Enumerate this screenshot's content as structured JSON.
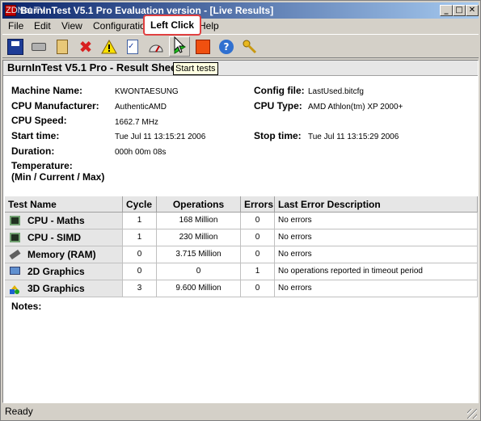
{
  "window": {
    "title": "BurnInTest V5.1 Pro Evaluation version - [Live Results]",
    "watermark": "ZDNet TV",
    "controls": {
      "minimize": "_",
      "maximize": "□",
      "close": "✕"
    }
  },
  "menu": {
    "items": [
      "File",
      "Edit",
      "View",
      "Configuration",
      "Help"
    ]
  },
  "toolbar": {
    "icons": [
      "save-icon",
      "print-icon",
      "clipboard-icon",
      "stop-icon",
      "warning-icon",
      "checklist-icon",
      "gauge-icon",
      "start-icon",
      "stop-square-icon",
      "help-icon",
      "key-icon"
    ]
  },
  "annotation": {
    "callout": "Left Click",
    "tooltip": "Start tests"
  },
  "sheet": {
    "header": "BurnInTest V5.1 Pro - Result Sheet",
    "machine_name_label": "Machine Name:",
    "machine_name": "KWONTAESUNG",
    "cpu_manufacturer_label": "CPU Manufacturer:",
    "cpu_manufacturer": "AuthenticAMD",
    "cpu_speed_label": "CPU Speed:",
    "cpu_speed": "1662.7 MHz",
    "start_time_label": "Start time:",
    "start_time": "Tue Jul 11 13:15:21 2006",
    "duration_label": "Duration:",
    "duration": "000h 00m 08s",
    "temperature_label": "Temperature:",
    "temperature_sub": "(Min / Current / Max)",
    "config_file_label": "Config file:",
    "config_file": "LastUsed.bitcfg",
    "cpu_type_label": "CPU Type:",
    "cpu_type": "AMD Athlon(tm) XP 2000+",
    "stop_time_label": "Stop time:",
    "stop_time": "Tue Jul 11 13:15:29 2006",
    "notes_label": "Notes:"
  },
  "table": {
    "headers": [
      "Test Name",
      "Cycle",
      "Operations",
      "Errors",
      "Last Error Description"
    ],
    "rows": [
      {
        "name": "CPU - Maths",
        "cycle": "1",
        "operations": "168 Million",
        "errors": "0",
        "description": "No errors",
        "icon": "chip-icon"
      },
      {
        "name": "CPU - SIMD",
        "cycle": "1",
        "operations": "230 Million",
        "errors": "0",
        "description": "No errors",
        "icon": "chip-icon"
      },
      {
        "name": "Memory (RAM)",
        "cycle": "0",
        "operations": "3.715 Million",
        "errors": "0",
        "description": "No errors",
        "icon": "memory-icon"
      },
      {
        "name": "2D Graphics",
        "cycle": "0",
        "operations": "0",
        "errors": "1",
        "description": "No operations reported in timeout period",
        "icon": "monitor-icon"
      },
      {
        "name": "3D Graphics",
        "cycle": "3",
        "operations": "9.600 Million",
        "errors": "0",
        "description": "No errors",
        "icon": "shapes-icon"
      }
    ]
  },
  "status": {
    "text": "Ready"
  }
}
